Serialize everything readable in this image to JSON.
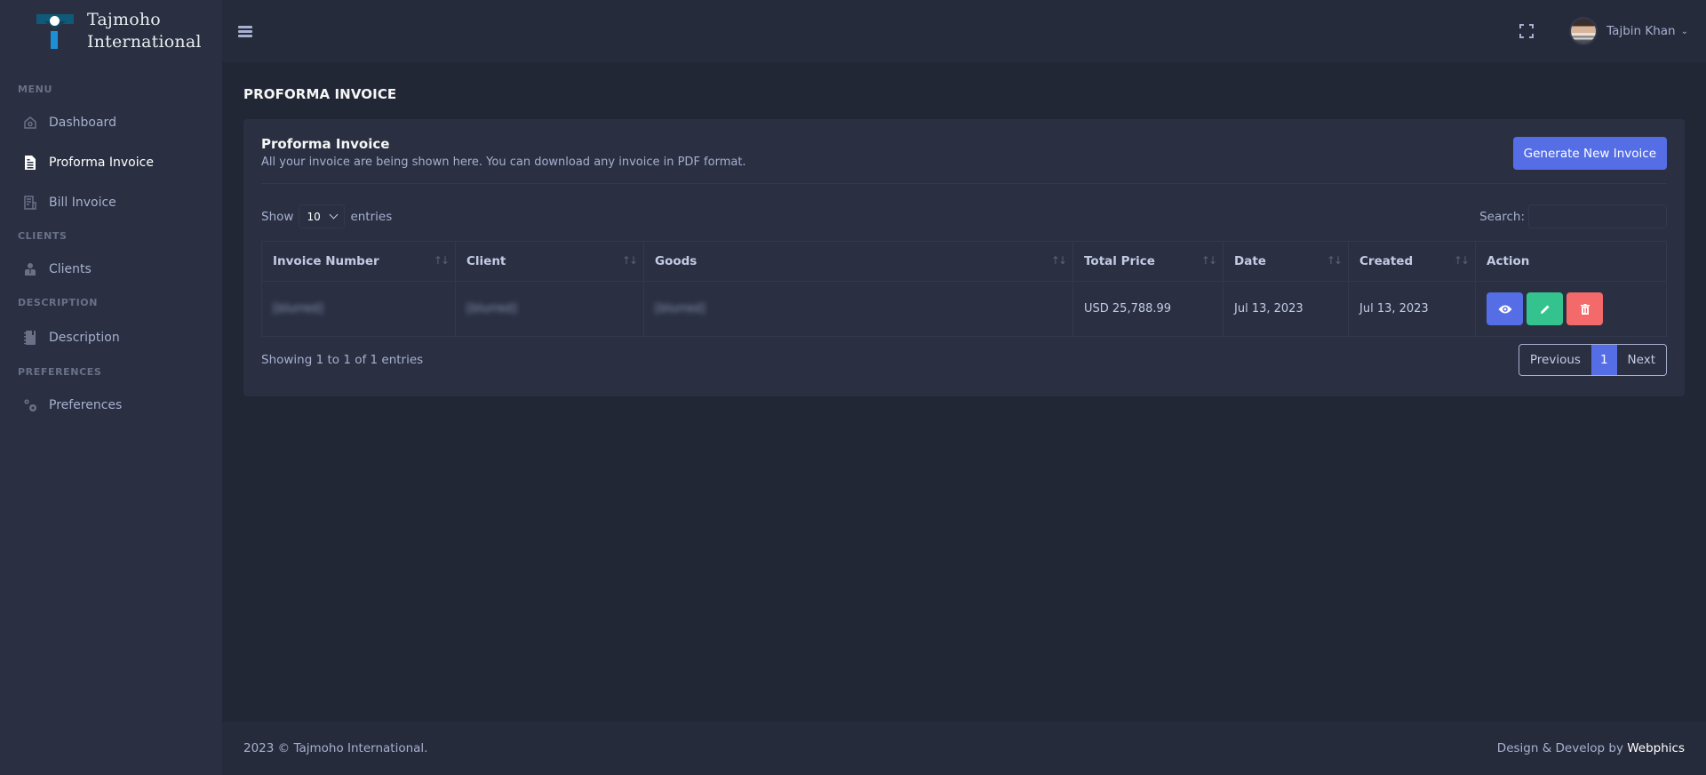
{
  "brand": {
    "line1": "Tajmoho",
    "line2": "International"
  },
  "sidebar": {
    "sections": [
      {
        "title": "MENU",
        "items": [
          {
            "label": "Dashboard",
            "icon": "home-icon",
            "active": false
          },
          {
            "label": "Proforma Invoice",
            "icon": "file-document-icon",
            "active": true
          },
          {
            "label": "Bill Invoice",
            "icon": "receipt-icon",
            "active": false
          }
        ]
      },
      {
        "title": "CLIENTS",
        "items": [
          {
            "label": "Clients",
            "icon": "user-tie-icon",
            "active": false
          }
        ]
      },
      {
        "title": "DESCRIPTION",
        "items": [
          {
            "label": "Description",
            "icon": "notebook-icon",
            "active": false
          }
        ]
      },
      {
        "title": "PREFERENCES",
        "items": [
          {
            "label": "Preferences",
            "icon": "cogs-icon",
            "active": false
          }
        ]
      }
    ]
  },
  "topbar": {
    "user_name": "Tajbin Khan"
  },
  "page": {
    "title": "PROFORMA INVOICE"
  },
  "card": {
    "title": "Proforma Invoice",
    "subtitle": "All your invoice are being shown here. You can download any invoice in PDF format.",
    "generate_button": "Generate New Invoice"
  },
  "datatable": {
    "show_label": "Show",
    "page_length": "10",
    "entries_label": "entries",
    "search_label": "Search:",
    "search_value": "",
    "columns": [
      "Invoice Number",
      "Client",
      "Goods",
      "Total Price",
      "Date",
      "Created",
      "Action"
    ],
    "rows": [
      {
        "invoice_number": "[blurred]",
        "client": "[blurred]",
        "goods": "[blurred]",
        "total_price": "USD 25,788.99",
        "date": "Jul 13, 2023",
        "created": "Jul 13, 2023"
      }
    ],
    "info": "Showing 1 to 1 of 1 entries",
    "pagination": {
      "previous": "Previous",
      "current": "1",
      "next": "Next"
    }
  },
  "footer": {
    "copyright": "2023 © Tajmoho International.",
    "credit_prefix": "Design & Develop by ",
    "credit_name": "Webphics"
  },
  "colors": {
    "primary": "#556ee6",
    "success": "#34c38f",
    "danger": "#f46a6a",
    "sidebar_bg": "#2a3042",
    "body_bg": "#222736"
  }
}
